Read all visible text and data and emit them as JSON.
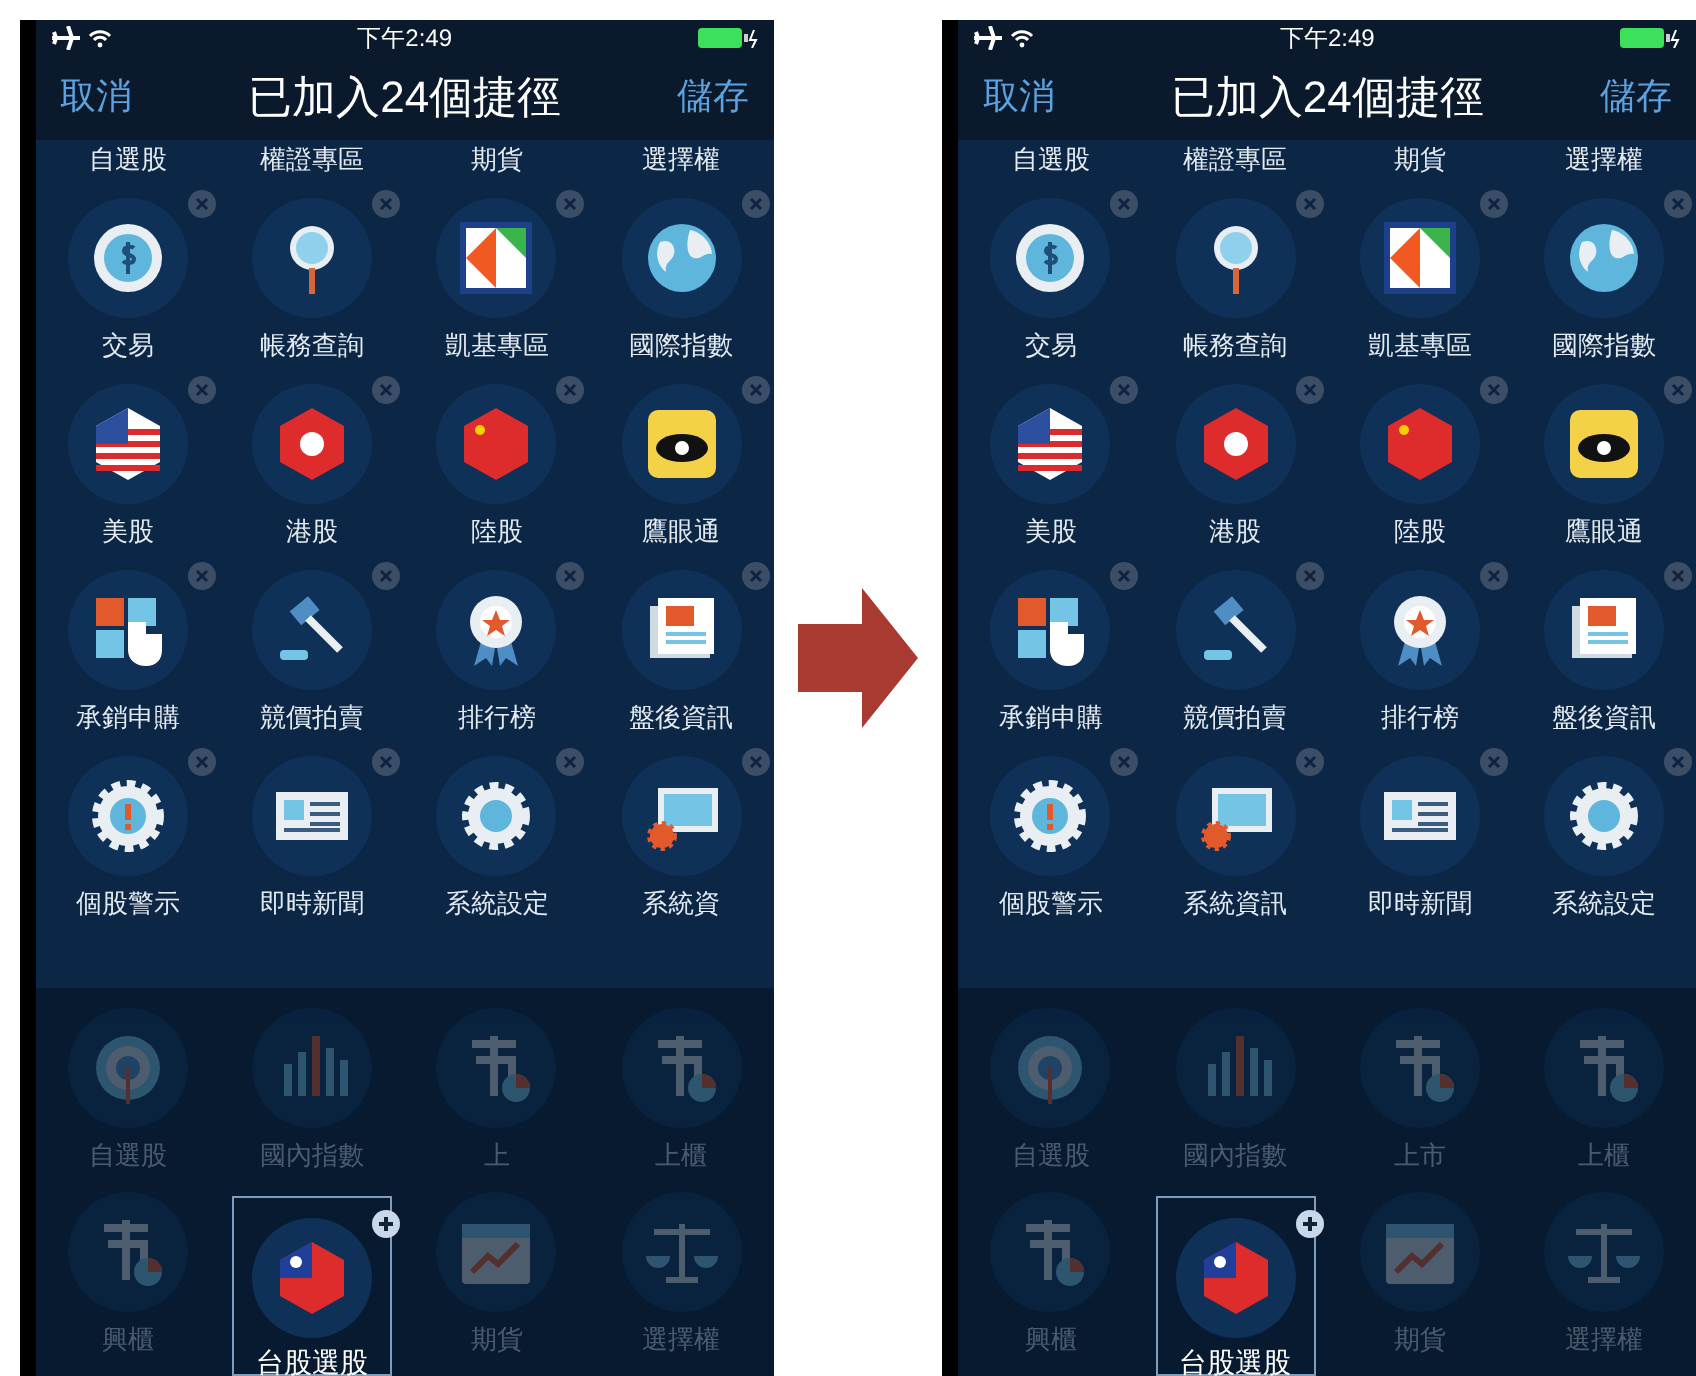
{
  "phones": [
    {
      "status_bar": {
        "time": "下午2:49"
      },
      "nav": {
        "cancel": "取消",
        "title": "已加入24個捷徑",
        "save": "儲存"
      },
      "header_labels": [
        "自選股",
        "權證專區",
        "期貨",
        "選擇權"
      ],
      "shortcuts": [
        {
          "label": "交易",
          "kind": "dollar"
        },
        {
          "label": "帳務查詢",
          "kind": "magnifier"
        },
        {
          "label": "凱基專區",
          "kind": "logo"
        },
        {
          "label": "國際指數",
          "kind": "globe"
        },
        {
          "label": "美股",
          "kind": "usflag"
        },
        {
          "label": "港股",
          "kind": "hkflag"
        },
        {
          "label": "陸股",
          "kind": "cnflag"
        },
        {
          "label": "鷹眼通",
          "kind": "eye"
        },
        {
          "label": "承銷申購",
          "kind": "touch"
        },
        {
          "label": "競價拍賣",
          "kind": "gavel"
        },
        {
          "label": "排行榜",
          "kind": "medal"
        },
        {
          "label": "盤後資訊",
          "kind": "newspaper"
        },
        {
          "label": "個股警示",
          "kind": "alert"
        },
        {
          "label": "即時新聞",
          "kind": "news"
        },
        {
          "label": "系統設定",
          "kind": "settings"
        },
        {
          "label": "系統資",
          "kind": "monitor"
        }
      ],
      "available": [
        {
          "label": "自選股",
          "kind": "target",
          "selected": false
        },
        {
          "label": "國內指數",
          "kind": "barchart",
          "selected": false
        },
        {
          "label": "上",
          "kind": "market",
          "selected": false
        },
        {
          "label": "上櫃",
          "kind": "counter",
          "selected": false
        },
        {
          "label": "興櫃",
          "kind": "emerging",
          "selected": false
        },
        {
          "label": "台股選股",
          "kind": "twflag",
          "selected": true
        },
        {
          "label": "期貨",
          "kind": "calendar",
          "selected": false
        },
        {
          "label": "選擇權",
          "kind": "scales",
          "selected": false
        }
      ]
    },
    {
      "status_bar": {
        "time": "下午2:49"
      },
      "nav": {
        "cancel": "取消",
        "title": "已加入24個捷徑",
        "save": "儲存"
      },
      "header_labels": [
        "自選股",
        "權證專區",
        "期貨",
        "選擇權"
      ],
      "shortcuts": [
        {
          "label": "交易",
          "kind": "dollar"
        },
        {
          "label": "帳務查詢",
          "kind": "magnifier"
        },
        {
          "label": "凱基專區",
          "kind": "logo"
        },
        {
          "label": "國際指數",
          "kind": "globe"
        },
        {
          "label": "美股",
          "kind": "usflag"
        },
        {
          "label": "港股",
          "kind": "hkflag"
        },
        {
          "label": "陸股",
          "kind": "cnflag"
        },
        {
          "label": "鷹眼通",
          "kind": "eye"
        },
        {
          "label": "承銷申購",
          "kind": "touch"
        },
        {
          "label": "競價拍賣",
          "kind": "gavel"
        },
        {
          "label": "排行榜",
          "kind": "medal"
        },
        {
          "label": "盤後資訊",
          "kind": "newspaper"
        },
        {
          "label": "個股警示",
          "kind": "alert"
        },
        {
          "label": "系統資訊",
          "kind": "monitor"
        },
        {
          "label": "即時新聞",
          "kind": "news"
        },
        {
          "label": "系統設定",
          "kind": "settings"
        }
      ],
      "available": [
        {
          "label": "自選股",
          "kind": "target",
          "selected": false
        },
        {
          "label": "國內指數",
          "kind": "barchart",
          "selected": false
        },
        {
          "label": "上市",
          "kind": "market",
          "selected": false
        },
        {
          "label": "上櫃",
          "kind": "counter",
          "selected": false
        },
        {
          "label": "興櫃",
          "kind": "emerging",
          "selected": false
        },
        {
          "label": "台股選股",
          "kind": "twflag",
          "selected": true
        },
        {
          "label": "期貨",
          "kind": "calendar",
          "selected": false
        },
        {
          "label": "選擇權",
          "kind": "scales",
          "selected": false
        }
      ]
    }
  ]
}
